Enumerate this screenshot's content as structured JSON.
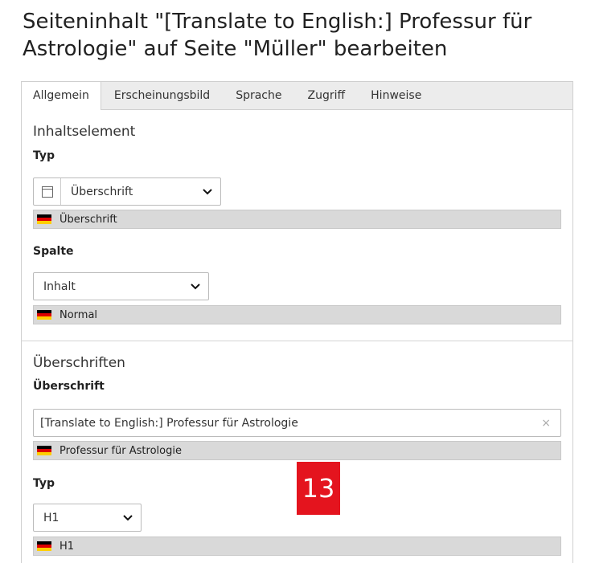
{
  "page": {
    "title": "Seiteninhalt \"[Translate to English:] Professur für Astrologie\" auf Seite \"Müller\" bearbeiten"
  },
  "tabs": [
    "Allgemein",
    "Erscheinungsbild",
    "Sprache",
    "Zugriff",
    "Hinweise"
  ],
  "active_tab": "Allgemein",
  "inhaltselement": {
    "section_title": "Inhaltselement",
    "typ": {
      "label": "Typ",
      "value": "Überschrift",
      "icon": "header-content-icon",
      "reference": "Überschrift"
    },
    "spalte": {
      "label": "Spalte",
      "value": "Inhalt",
      "reference": "Normal"
    }
  },
  "ueberschriften": {
    "section_title": "Überschriften",
    "ueberschrift": {
      "label": "Überschrift",
      "value": "[Translate to English:] Professur für Astrologie",
      "clear": "×",
      "reference": "Professur für Astrologie"
    },
    "typ": {
      "label": "Typ",
      "value": "H1",
      "reference": "H1"
    }
  },
  "reference_flag": "germany-flag-icon",
  "badge": {
    "text": "13",
    "color": "#e4141e"
  }
}
